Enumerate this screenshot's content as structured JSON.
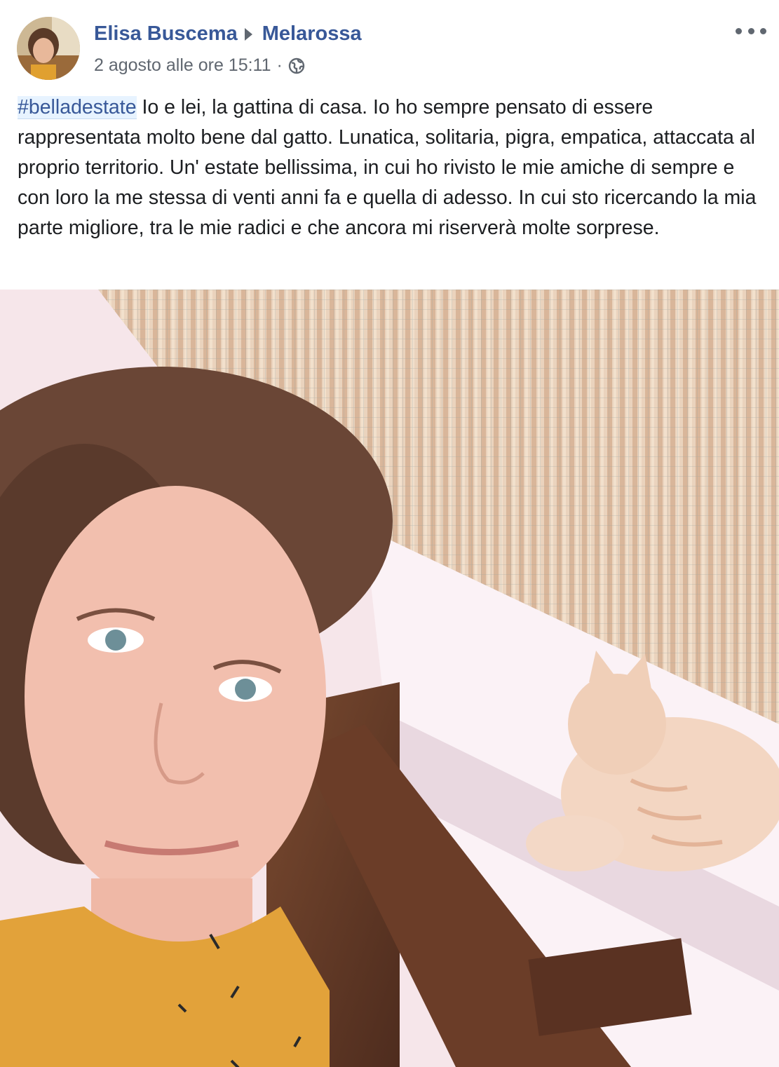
{
  "post": {
    "author": "Elisa Buscema",
    "group": "Melarossa",
    "timestamp": "2 agosto alle ore 15:11",
    "separator": "·",
    "privacy_icon": "globe-icon",
    "more_icon": "more-options-icon",
    "hashtag": "#belladestate",
    "body": " Io e lei, la gattina di casa. Io ho sempre pensato di essere rappresentata molto bene dal gatto. Lunatica, solitaria, pigra, empatica, attaccata al proprio territorio. Un' estate bellissima, in cui ho rivisto le mie amiche di sempre e con loro la me stessa di venti anni fa e quella di adesso. In cui sto ricercando la mia parte migliore, tra le mie radici e che ancora mi riserverà molte sorprese."
  },
  "colors": {
    "link": "#385898",
    "text": "#1c1e21",
    "meta": "#606770",
    "hashtag_bg": "#e7f3ff"
  }
}
